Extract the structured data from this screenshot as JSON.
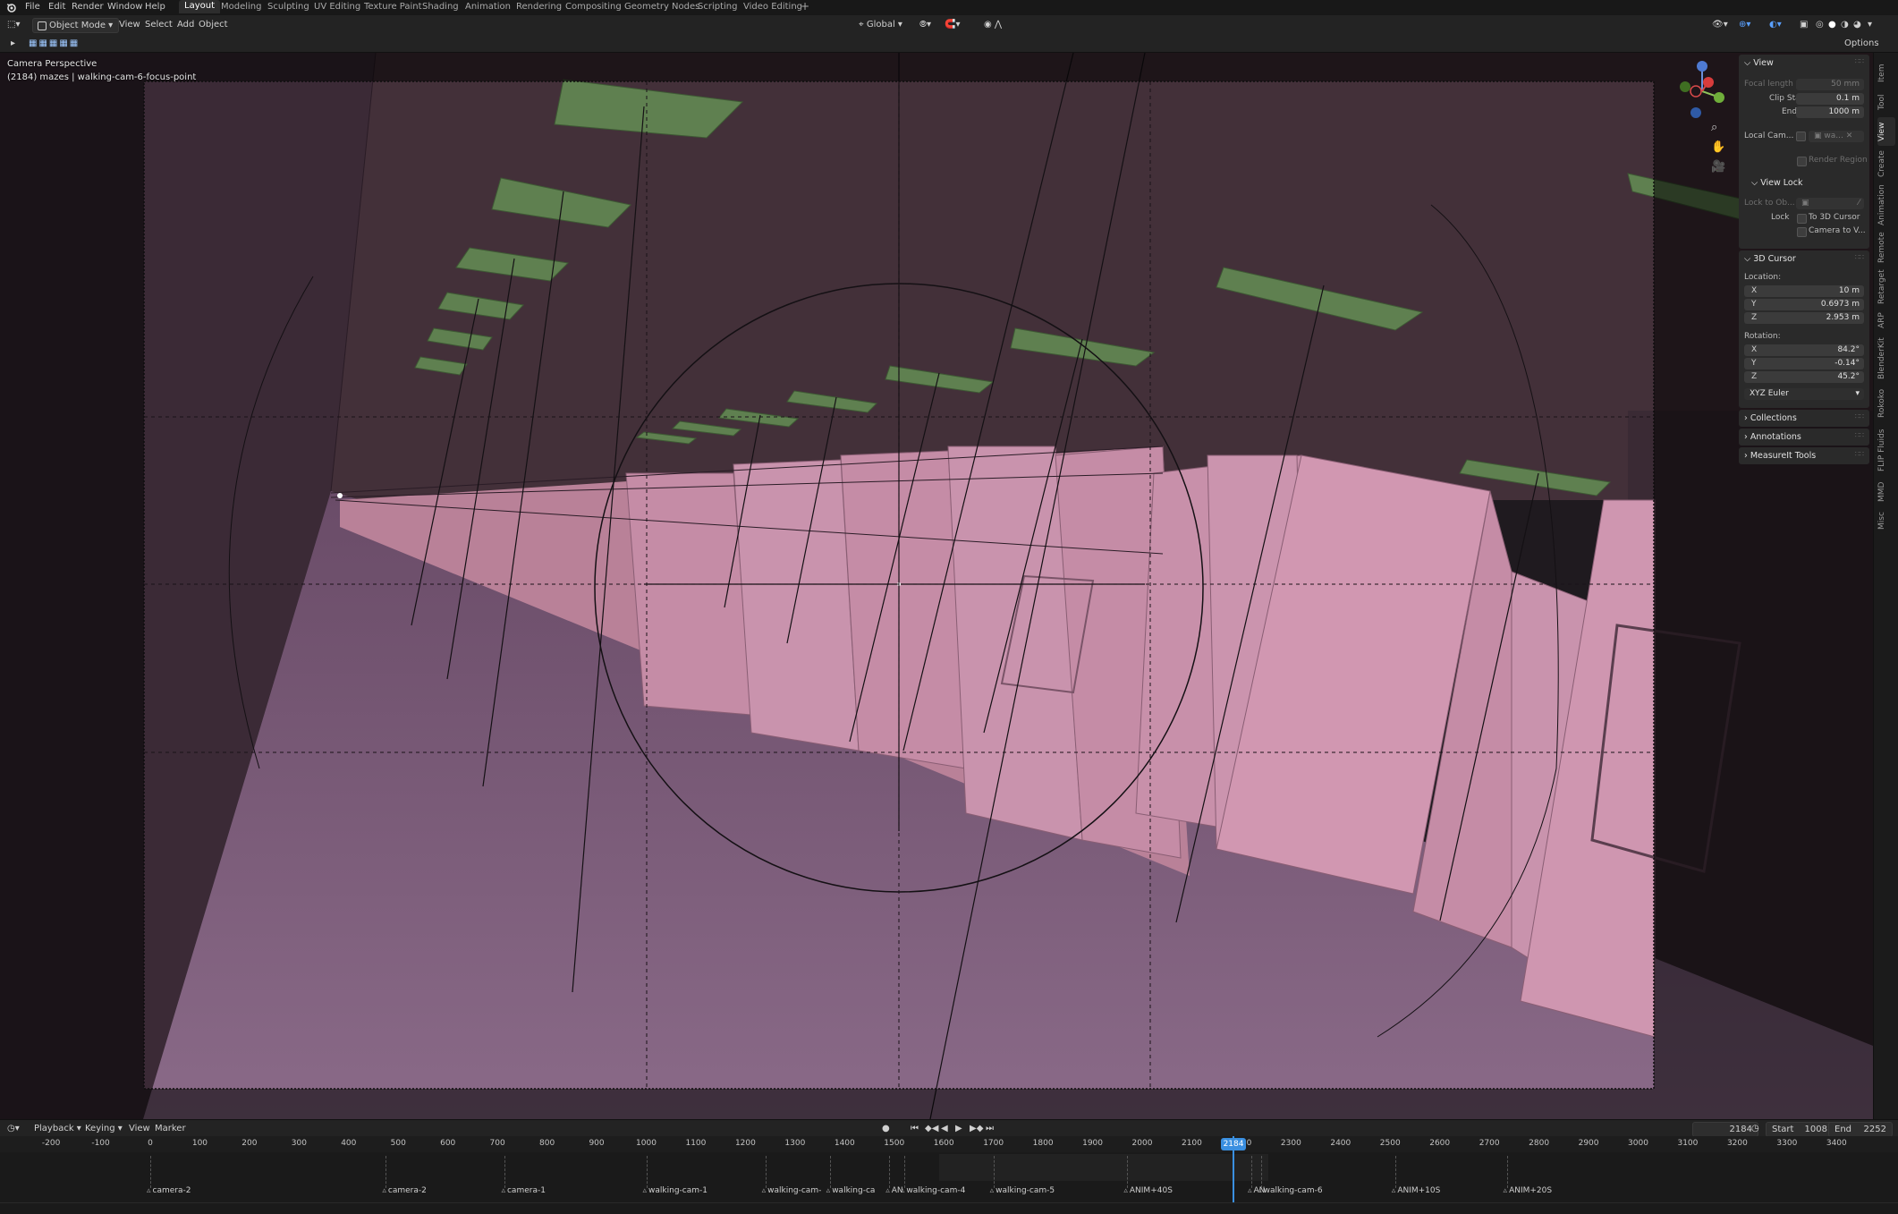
{
  "topbar": {
    "menus": [
      "File",
      "Edit",
      "Render",
      "Window",
      "Help"
    ],
    "workspaces": [
      "Layout",
      "Modeling",
      "Sculpting",
      "UV Editing",
      "Texture Paint",
      "Shading",
      "Animation",
      "Rendering",
      "Compositing",
      "Geometry Nodes",
      "Scripting",
      "Video Editing"
    ],
    "active_workspace": "Layout",
    "add_tab": "+"
  },
  "header": {
    "mode": "Object Mode",
    "menus": [
      "View",
      "Select",
      "Add",
      "Object"
    ],
    "orientation": "Global",
    "options": "Options"
  },
  "viewport": {
    "overlay_line1": "Camera Perspective",
    "overlay_line2": "(2184) mazes | walking-cam-6-focus-point",
    "colors": {
      "floor": "#80607e",
      "wall": "#c98aa6",
      "ceiling": "#433039",
      "lamp": "#5a7a4a",
      "frame": "#8a6a84"
    }
  },
  "npanel": {
    "view": {
      "title": "View",
      "focal_length_label": "Focal length",
      "focal_length": "50 mm",
      "clip_start_label": "Clip Start",
      "clip_start": "0.1 m",
      "end_label": "End",
      "end": "1000 m",
      "local_camera_label": "Local Cam...",
      "local_camera": "wa...",
      "render_region": "Render Region"
    },
    "view_lock": {
      "title": "View Lock",
      "lock_to_object_label": "Lock to Ob...",
      "lock_label": "Lock",
      "to_3d_cursor": "To 3D Cursor",
      "camera_to_view": "Camera to V..."
    },
    "cursor": {
      "title": "3D Cursor",
      "location_label": "Location:",
      "x": "10 m",
      "y": "0.6973 m",
      "z": "2.953 m",
      "rotation_label": "Rotation:",
      "rx": "84.2°",
      "ry": "-0.14°",
      "rz": "45.2°",
      "mode": "XYZ Euler"
    },
    "collapsed": [
      "Collections",
      "Annotations",
      "MeasureIt Tools"
    ]
  },
  "side_tabs": [
    "Item",
    "Tool",
    "View",
    "Create",
    "Animation",
    "Remote",
    "Retarget",
    "ARP",
    "BlenderKit",
    "Rokoko",
    "FLIP Fluids",
    "MMD",
    "Misc"
  ],
  "active_side_tab": "View",
  "timeline": {
    "menus": [
      "Playback",
      "Keying",
      "View",
      "Marker"
    ],
    "current_frame": "2184",
    "start_label": "Start",
    "start": "1008",
    "end_label": "End",
    "end": "2252",
    "ruler": [
      "-200",
      "-100",
      "0",
      "100",
      "200",
      "300",
      "400",
      "500",
      "600",
      "700",
      "800",
      "900",
      "1000",
      "1100",
      "1200",
      "1300",
      "1400",
      "1500",
      "1600",
      "1700",
      "1800",
      "1900",
      "2000",
      "2100",
      "2200",
      "2300",
      "2400",
      "2500",
      "2600",
      "2700",
      "2800",
      "2900",
      "3000",
      "3100",
      "3200",
      "3300",
      "3400"
    ],
    "playhead_label": "2184",
    "markers": [
      {
        "frame": 0,
        "label": "camera-2"
      },
      {
        "frame": 475,
        "label": "camera-2"
      },
      {
        "frame": 715,
        "label": "camera-1"
      },
      {
        "frame": 1000,
        "label": "walking-cam-1"
      },
      {
        "frame": 1240,
        "label": "walking-cam-"
      },
      {
        "frame": 1370,
        "label": "walking-ca"
      },
      {
        "frame": 1490,
        "label": "AN"
      },
      {
        "frame": 1520,
        "label": "walking-cam-4"
      },
      {
        "frame": 1700,
        "label": "walking-cam-5"
      },
      {
        "frame": 1970,
        "label": "ANIM+40S"
      },
      {
        "frame": 2220,
        "label": "AN"
      },
      {
        "frame": 2240,
        "label": "walking-cam-6"
      },
      {
        "frame": 2510,
        "label": "ANIM+10S"
      },
      {
        "frame": 2735,
        "label": "ANIM+20S"
      }
    ]
  }
}
